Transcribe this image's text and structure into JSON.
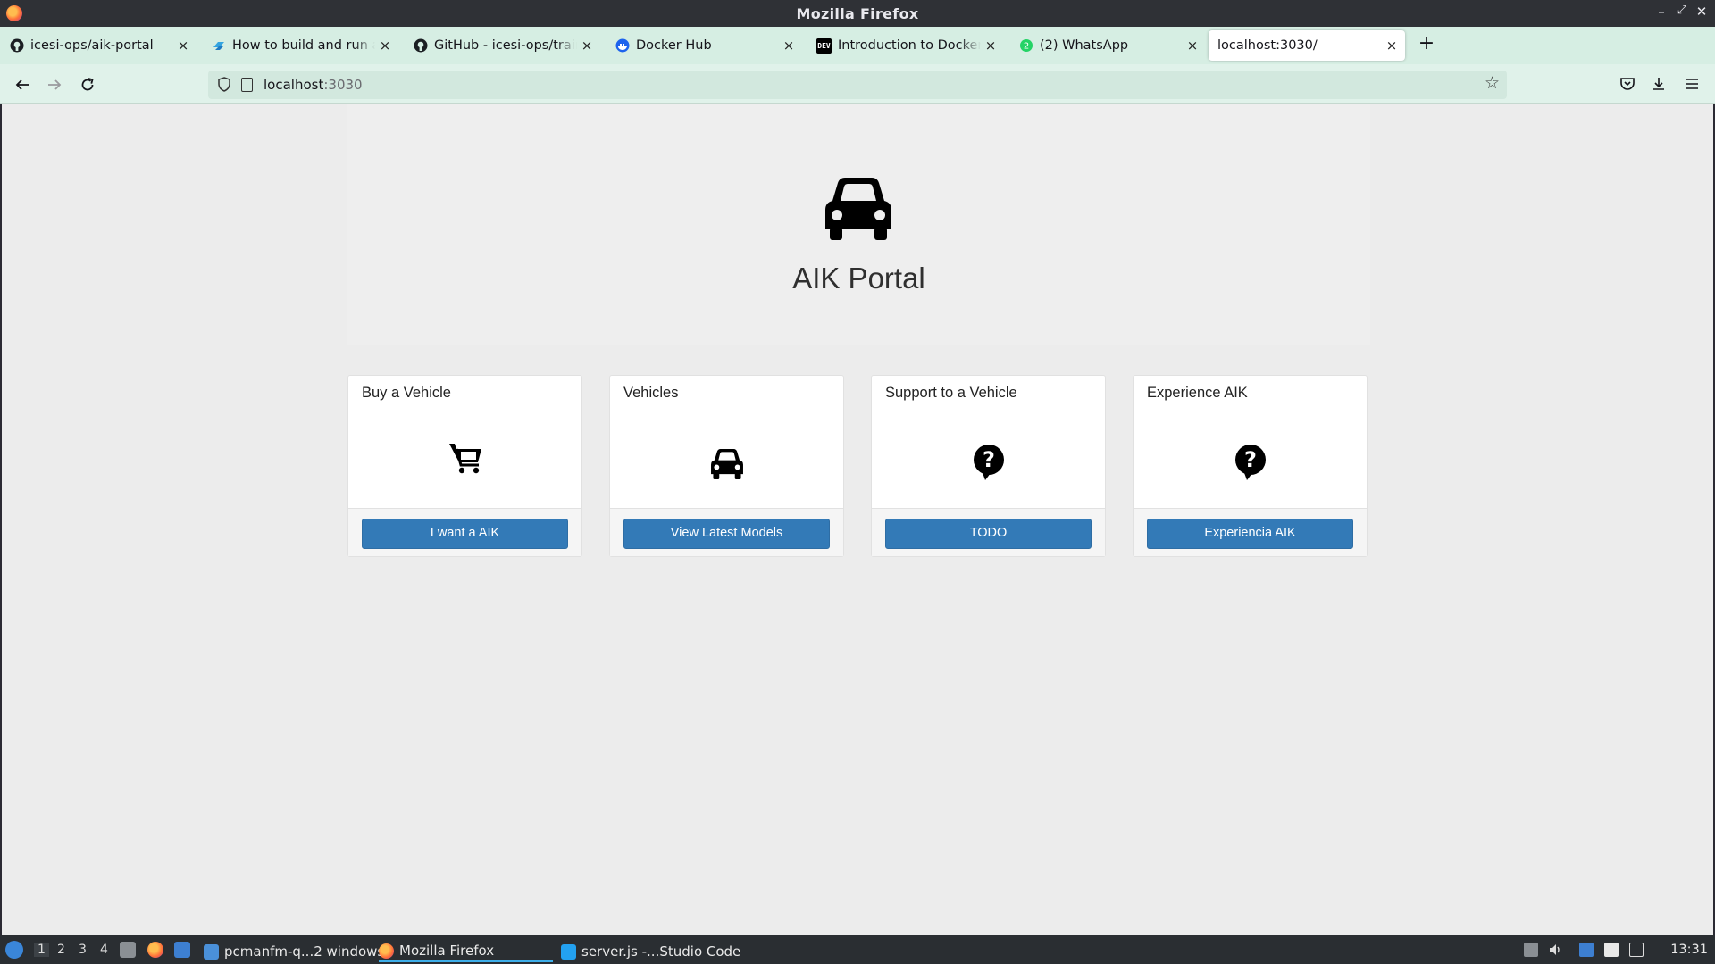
{
  "window": {
    "title": "Mozilla Firefox",
    "minimize_glyph": "–",
    "maximize_glyph": "⤢",
    "close_glyph": "✕"
  },
  "tabs": [
    {
      "label": "icesi-ops/aik-portal",
      "icon": "github-icon"
    },
    {
      "label": "How to build and run a Python app in a container",
      "icon": "vscode-icon"
    },
    {
      "label": "GitHub - icesi-ops/training",
      "icon": "github-icon"
    },
    {
      "label": "Docker Hub",
      "icon": "docker-icon"
    },
    {
      "label": "Introduction to Docker for",
      "icon": "dev-icon"
    },
    {
      "label": "(2) WhatsApp",
      "icon": "whatsapp-icon"
    },
    {
      "label": "localhost:3030/",
      "icon": "none",
      "active": true
    }
  ],
  "tab_close_glyph": "×",
  "new_tab_glyph": "+",
  "navigation": {
    "url_host": "localhost",
    "url_port": ":3030"
  },
  "page": {
    "heading": "AIK Portal",
    "cards": [
      {
        "title": "Buy a Vehicle",
        "icon": "shopping-cart-icon",
        "button": "I want a AIK"
      },
      {
        "title": "Vehicles",
        "icon": "car-icon",
        "button": "View Latest Models"
      },
      {
        "title": "Support to a Vehicle",
        "icon": "question-bubble-icon",
        "button": "TODO"
      },
      {
        "title": "Experience AIK",
        "icon": "question-bubble-icon",
        "button": "Experiencia AIK"
      }
    ]
  },
  "taskbar": {
    "workspaces": [
      "1",
      "2",
      "3",
      "4"
    ],
    "tasks": [
      {
        "label": "pcmanfm-q...2 windows",
        "icon": "folder-icon"
      },
      {
        "label": "Mozilla Firefox",
        "icon": "firefox-icon",
        "active": true
      },
      {
        "label": "server.js -...Studio Code",
        "icon": "vscode-icon"
      }
    ],
    "clock": "13:31"
  },
  "colors": {
    "tabstrip_bg": "#d6eee3",
    "navbar_bg": "#e0f2ea",
    "page_bg": "#ececec",
    "button_primary": "#337ab7"
  }
}
